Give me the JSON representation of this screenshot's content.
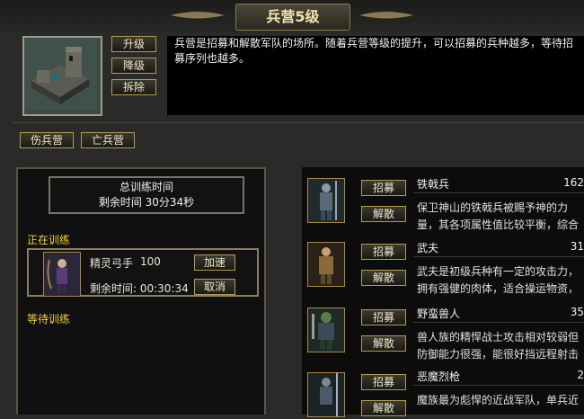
{
  "header": {
    "title": "兵营5级"
  },
  "building": {
    "actions": {
      "upgrade": "升级",
      "downgrade": "降级",
      "demolish": "拆除"
    },
    "description": "兵营是招募和解散军队的场所。随着兵营等级的提升，可以招募的兵种越多，等待招募序列也越多。"
  },
  "tabs": {
    "wounded": "伤兵营",
    "dead": "亡兵营"
  },
  "training": {
    "total_label": "总训练时间",
    "remaining_total": "剩余时间 30分34秒",
    "in_training_label": "正在训练",
    "waiting_label": "等待训练",
    "current": {
      "unit": "精灵弓手",
      "count": "100",
      "time_remaining": "剩余时间: 00:30:34",
      "speedup": "加速",
      "cancel": "取消"
    }
  },
  "units": [
    {
      "name": "铁戟兵",
      "count": "162",
      "desc1": "保卫神山的铁戟兵被赐予神的力",
      "desc2": "量，其各项属性值比较平衡，综合",
      "recruit": "招募",
      "dismiss": "解散"
    },
    {
      "name": "武夫",
      "count": "31",
      "desc1": "武夫是初级兵种有一定的攻击力，",
      "desc2": "拥有强健的肉体，适合操运物资，",
      "recruit": "招募",
      "dismiss": "解散"
    },
    {
      "name": "野蛮兽人",
      "count": "35",
      "desc1": "兽人族的精悍战士攻击相对较弱但",
      "desc2": "防御能力很强，能很好挡远程射击",
      "recruit": "招募",
      "dismiss": "解散"
    },
    {
      "name": "恶魔烈枪",
      "count": "2",
      "desc1": "魔族最为彪悍的近战军队，单兵近",
      "desc2": "",
      "recruit": "招募",
      "dismiss": "解散"
    }
  ]
}
